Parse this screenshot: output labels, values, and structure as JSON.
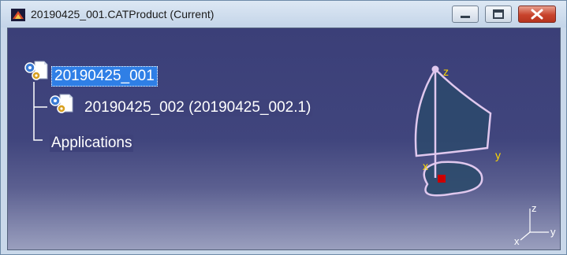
{
  "window": {
    "title": "20190425_001.CATProduct (Current)",
    "icon": "catia-app-icon",
    "buttons": [
      "minimize",
      "maximize",
      "close"
    ]
  },
  "tree": {
    "root_label": "20190425_001",
    "child_label": "20190425_002 (20190425_002.1)",
    "applications_label": "Applications"
  },
  "compass": {
    "z_label": "z",
    "y_label": "y",
    "x_label": "x"
  },
  "axis_triad": {
    "z_label": "z",
    "y_label": "y",
    "x_label": "x"
  },
  "colors": {
    "viewport_top": "#3b3f78",
    "viewport_bottom": "#9a9fbe",
    "selection": "#2f7fe6",
    "compass_stroke": "#e0c8ee",
    "compass_fill": "#2a4a6a",
    "compass_label": "#ffd800",
    "compass_origin": "#cc0000"
  }
}
